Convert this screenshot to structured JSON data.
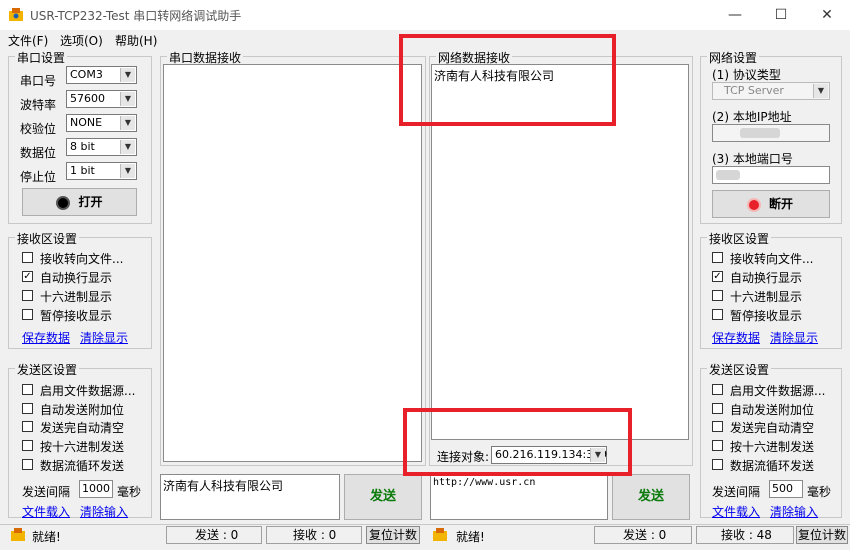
{
  "window": {
    "title": "USR-TCP232-Test 串口转网络调试助手",
    "minimize": "—",
    "maximize": "☐",
    "close": "✕"
  },
  "menu": [
    "文件(F)",
    "选项(O)",
    "帮助(H)"
  ],
  "serial_settings": {
    "title": "串口设置",
    "rows": [
      {
        "label": "串口号",
        "value": "COM3"
      },
      {
        "label": "波特率",
        "value": "57600"
      },
      {
        "label": "校验位",
        "value": "NONE"
      },
      {
        "label": "数据位",
        "value": "8 bit"
      },
      {
        "label": "停止位",
        "value": "1 bit"
      }
    ],
    "open_button": "打开"
  },
  "left_receive": {
    "title": "接收区设置",
    "options": [
      {
        "label": "接收转向文件...",
        "checked": false
      },
      {
        "label": "自动换行显示",
        "checked": true
      },
      {
        "label": "十六进制显示",
        "checked": false
      },
      {
        "label": "暂停接收显示",
        "checked": false
      }
    ],
    "save_link": "保存数据",
    "clear_link": "清除显示"
  },
  "left_send": {
    "title": "发送区设置",
    "options": [
      {
        "label": "启用文件数据源...",
        "checked": false
      },
      {
        "label": "自动发送附加位",
        "checked": false
      },
      {
        "label": "发送完自动清空",
        "checked": false
      },
      {
        "label": "按十六进制发送",
        "checked": false
      },
      {
        "label": "数据流循环发送",
        "checked": false
      }
    ],
    "interval_label": "发送间隔",
    "interval_value": "1000",
    "interval_unit": "毫秒",
    "file_link": "文件载入",
    "clear_link": "清除输入"
  },
  "serial_receive": {
    "title": "串口数据接收",
    "content": ""
  },
  "serial_send": {
    "content": "济南有人科技有限公司",
    "send_button": "发送"
  },
  "net_receive": {
    "title": "网络数据接收",
    "content": "济南有人科技有限公司"
  },
  "net_connect": {
    "label": "连接对象:",
    "value": "60.216.119.134:389"
  },
  "net_send": {
    "content": "http://www.usr.cn",
    "send_button": "发送"
  },
  "net_settings": {
    "title": "网络设置",
    "protocol_label": "(1) 协议类型",
    "protocol_value": "TCP Server",
    "ip_label": "(2) 本地IP地址",
    "port_label": "(3) 本地端口号",
    "disconnect_button": "断开"
  },
  "right_receive": {
    "title": "接收区设置",
    "options": [
      {
        "label": "接收转向文件...",
        "checked": false
      },
      {
        "label": "自动换行显示",
        "checked": true
      },
      {
        "label": "十六进制显示",
        "checked": false
      },
      {
        "label": "暂停接收显示",
        "checked": false
      }
    ],
    "save_link": "保存数据",
    "clear_link": "清除显示"
  },
  "right_send": {
    "title": "发送区设置",
    "options": [
      {
        "label": "启用文件数据源...",
        "checked": false
      },
      {
        "label": "自动发送附加位",
        "checked": false
      },
      {
        "label": "发送完自动清空",
        "checked": false
      },
      {
        "label": "按十六进制发送",
        "checked": false
      },
      {
        "label": "数据流循环发送",
        "checked": false
      }
    ],
    "interval_label": "发送间隔",
    "interval_value": "500",
    "interval_unit": "毫秒",
    "file_link": "文件载入",
    "clear_link": "清除输入"
  },
  "status_left": {
    "ready": "就绪!",
    "send": "发送 : 0",
    "recv": "接收 : 0",
    "reset": "复位计数"
  },
  "status_right": {
    "ready": "就绪!",
    "send": "发送 : 0",
    "recv": "接收 : 48",
    "reset": "复位计数"
  },
  "colors": {
    "highlight_box": "#e8202a",
    "link": "#0000ee",
    "send_button_text": "#0a7a0a"
  }
}
